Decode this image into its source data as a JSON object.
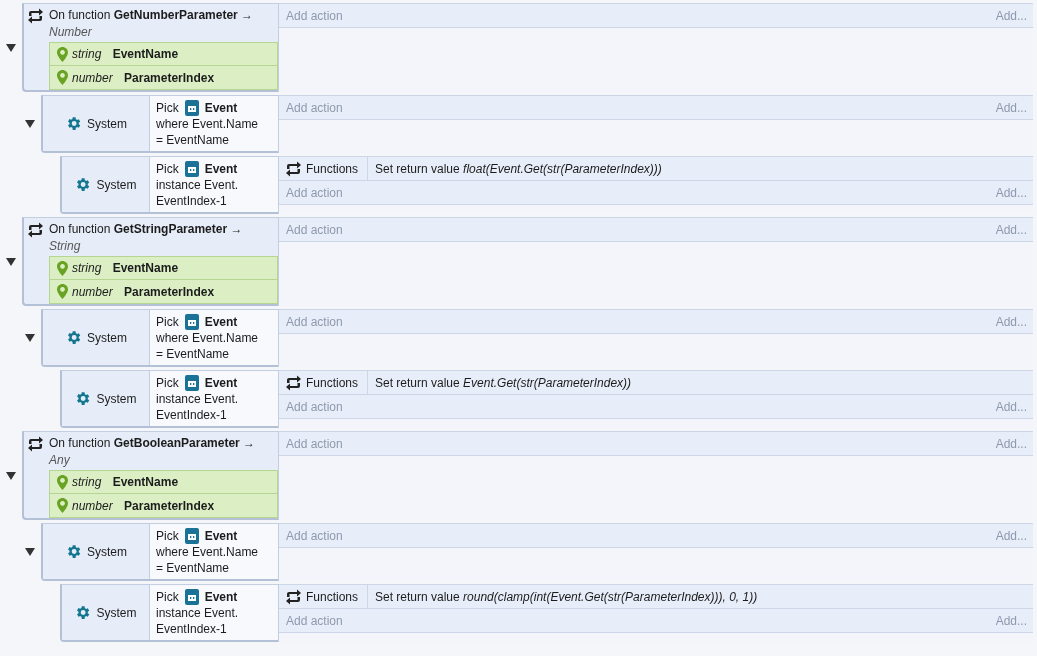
{
  "events": [
    {
      "kind": "function",
      "expanded": true,
      "prefix": "On function",
      "name": "GetNumberParameter",
      "arrow": "→",
      "return_type": "Number",
      "params": [
        {
          "type": "string",
          "name": "EventName"
        },
        {
          "type": "number",
          "name": "ParameterIndex"
        }
      ],
      "add_action": "Add action",
      "add_short": "Add...",
      "children": [
        {
          "kind": "pick",
          "expanded": true,
          "object": "System",
          "pick_label": "Pick",
          "pick_object": "Event",
          "pick_lines": [
            "where Event.Name",
            "= EventName"
          ],
          "add_action": "Add action",
          "add_short": "Add...",
          "children": [
            {
              "kind": "pick",
              "object": "System",
              "pick_label": "Pick",
              "pick_object": "Event",
              "pick_lines": [
                "instance Event.",
                "EventIndex-1"
              ],
              "actions": [
                {
                  "object": "Functions",
                  "label": "Set return value",
                  "expression": "float(Event.Get(str(ParameterIndex)))"
                }
              ],
              "add_action": "Add action",
              "add_short": "Add..."
            }
          ]
        }
      ]
    },
    {
      "kind": "function",
      "expanded": true,
      "prefix": "On function",
      "name": "GetStringParameter",
      "arrow": "→",
      "return_type": "String",
      "params": [
        {
          "type": "string",
          "name": "EventName"
        },
        {
          "type": "number",
          "name": "ParameterIndex"
        }
      ],
      "add_action": "Add action",
      "add_short": "Add...",
      "children": [
        {
          "kind": "pick",
          "expanded": true,
          "object": "System",
          "pick_label": "Pick",
          "pick_object": "Event",
          "pick_lines": [
            "where Event.Name",
            "= EventName"
          ],
          "add_action": "Add action",
          "add_short": "Add...",
          "children": [
            {
              "kind": "pick",
              "object": "System",
              "pick_label": "Pick",
              "pick_object": "Event",
              "pick_lines": [
                "instance Event.",
                "EventIndex-1"
              ],
              "actions": [
                {
                  "object": "Functions",
                  "label": "Set return value",
                  "expression": "Event.Get(str(ParameterIndex))"
                }
              ],
              "add_action": "Add action",
              "add_short": "Add..."
            }
          ]
        }
      ]
    },
    {
      "kind": "function",
      "expanded": true,
      "prefix": "On function",
      "name": "GetBooleanParameter",
      "arrow": "→",
      "return_type": "Any",
      "params": [
        {
          "type": "string",
          "name": "EventName"
        },
        {
          "type": "number",
          "name": "ParameterIndex"
        }
      ],
      "add_action": "Add action",
      "add_short": "Add...",
      "children": [
        {
          "kind": "pick",
          "expanded": true,
          "object": "System",
          "pick_label": "Pick",
          "pick_object": "Event",
          "pick_lines": [
            "where Event.Name",
            "= EventName"
          ],
          "add_action": "Add action",
          "add_short": "Add...",
          "children": [
            {
              "kind": "pick",
              "object": "System",
              "pick_label": "Pick",
              "pick_object": "Event",
              "pick_lines": [
                "instance Event.",
                "EventIndex-1"
              ],
              "actions": [
                {
                  "object": "Functions",
                  "label": "Set return value",
                  "expression": "round(clamp(int(Event.Get(str(ParameterIndex))), 0, 1))"
                }
              ],
              "add_action": "Add action",
              "add_short": "Add..."
            }
          ]
        }
      ]
    }
  ]
}
